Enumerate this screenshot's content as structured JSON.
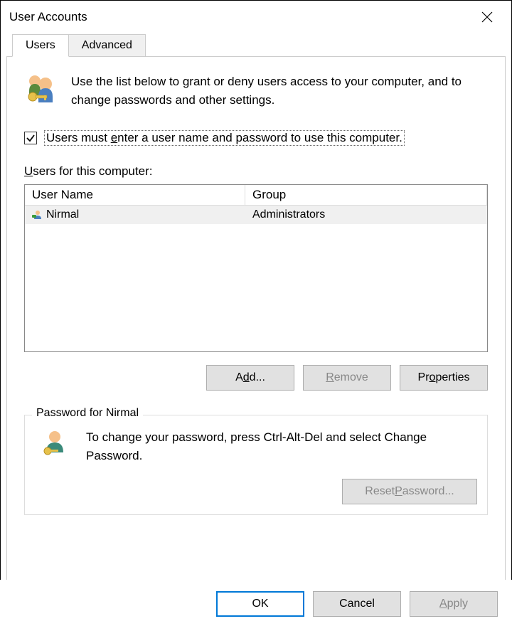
{
  "title": "User Accounts",
  "tabs": [
    {
      "label": "Users",
      "active": true
    },
    {
      "label": "Advanced",
      "active": false
    }
  ],
  "intro_text": "Use the list below to grant or deny users access to your computer, and to change passwords and other settings.",
  "checkbox": {
    "label_prefix": "Users must ",
    "label_underlined": "e",
    "label_suffix": "nter a user name and password to use this computer.",
    "checked": true
  },
  "users_label_underlined": "U",
  "users_label_rest": "sers for this computer:",
  "columns": {
    "name": "User Name",
    "group": "Group"
  },
  "rows": [
    {
      "name": "Nirmal",
      "group": "Administrators"
    }
  ],
  "buttons": {
    "add_prefix": "A",
    "add_underlined": "d",
    "add_suffix": "d...",
    "remove_underlined": "R",
    "remove_rest": "emove",
    "properties_prefix": "Pr",
    "properties_underlined": "o",
    "properties_suffix": "perties"
  },
  "passwordbox": {
    "label_prefix": "Password for ",
    "label_user": "Nirmal",
    "text": "To change your password, press Ctrl-Alt-Del and select Change Password.",
    "reset_prefix": "Reset ",
    "reset_underlined": "P",
    "reset_suffix": "assword..."
  },
  "footer": {
    "ok": "OK",
    "cancel": "Cancel",
    "apply_underlined": "A",
    "apply_rest": "pply"
  }
}
